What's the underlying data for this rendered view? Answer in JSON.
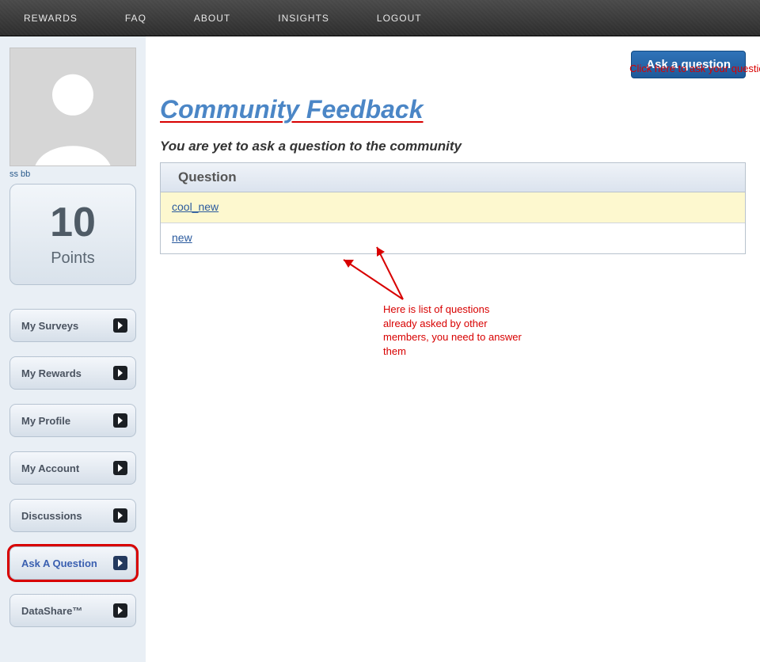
{
  "nav": {
    "rewards": "REWARDS",
    "faq": "FAQ",
    "about": "ABOUT",
    "insights": "INSIGHTS",
    "logout": "LOGOUT"
  },
  "user": {
    "name": "ss bb",
    "points_value": "10",
    "points_label": "Points"
  },
  "sidebar": {
    "items": [
      {
        "label": "My Surveys"
      },
      {
        "label": "My Rewards"
      },
      {
        "label": "My Profile"
      },
      {
        "label": "My Account"
      },
      {
        "label": "Discussions"
      },
      {
        "label": "Ask A Question"
      },
      {
        "label": "DataShare™"
      }
    ]
  },
  "main": {
    "ask_button": "Ask a question",
    "heading": "Community Feedback",
    "subheading": "You are yet to ask a question to the community",
    "table_header": "Question",
    "questions": [
      {
        "text": "cool_new"
      },
      {
        "text": "new"
      }
    ]
  },
  "annotations": {
    "top": "Click here to ask your question",
    "bottom": "Here is list of questions already asked by other members, you need to answer them"
  }
}
